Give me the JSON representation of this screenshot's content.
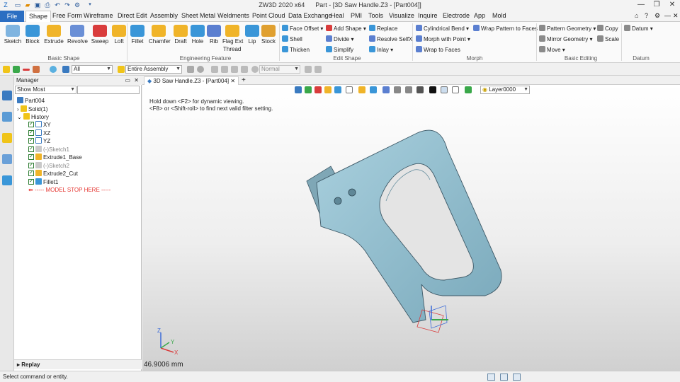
{
  "app": {
    "title": "ZW3D 2020 x64",
    "doc_title": "Part - [3D Saw Handle.Z3 - [Part004]]"
  },
  "window_controls": {
    "minimize": "—",
    "restore": "❐",
    "close": "✕"
  },
  "menu": {
    "file": "File",
    "tabs": [
      "Shape",
      "Free Form",
      "Wireframe",
      "Direct Edit",
      "Assembly",
      "Sheet Metal",
      "Weldments",
      "Point Cloud",
      "Data Exchange",
      "Heal",
      "PMI",
      "Tools",
      "Visualize",
      "Inquire",
      "Electrode",
      "App",
      "Mold"
    ]
  },
  "ribbon": {
    "basic_shape": {
      "label": "Basic Shape",
      "tools": [
        "Sketch",
        "Block",
        "Extrude",
        "Revolve",
        "Sweep",
        "Loft"
      ]
    },
    "engineering_feature": {
      "label": "Engineering Feature",
      "tools": [
        "Fillet",
        "Chamfer",
        "Draft",
        "Hole",
        "Rib",
        "Flag Ext",
        "Lip",
        "Stock"
      ],
      "extra": "Thread"
    },
    "edit_shape": {
      "label": "Edit Shape",
      "items": [
        "Face Offset",
        "Add Shape",
        "Replace",
        "Shell",
        "Divide",
        "Resolve SelfX",
        "Thicken",
        "Simplify",
        "Inlay"
      ]
    },
    "morph": {
      "label": "Morph",
      "items": [
        "Cylindrical Bend",
        "Wrap Pattern to Faces",
        "Morph with Point",
        "Wrap to Faces"
      ]
    },
    "basic_editing": {
      "label": "Basic Editing",
      "items": [
        "Pattern Geometry",
        "Copy",
        "Mirror Geometry",
        "Scale",
        "Move"
      ]
    },
    "datum": {
      "label": "Datum",
      "items": [
        "Datum"
      ]
    }
  },
  "toolbar2": {
    "filter_value": "All",
    "assembly_value": "Entire Assembly",
    "mode_value": "Normal"
  },
  "manager": {
    "title": "Manager",
    "filter": "Show Most",
    "root": "Part004",
    "solid": "Solid(1)",
    "history": "History",
    "items": [
      "XY",
      "XZ",
      "YZ",
      "(-)Sketch1",
      "Extrude1_Base",
      "(-)Sketch2",
      "Extrude2_Cut",
      "Fillet1"
    ],
    "stop": "----- MODEL STOP HERE -----",
    "replay": "Replay"
  },
  "viewport": {
    "tab": "3D Saw Handle.Z3 - [Part004]",
    "add_tab": "+",
    "layer": "Layer0000",
    "hint1": "Hold down <F2> for dynamic viewing.",
    "hint2": "<F8> or <Shift-roll> to find next valid filter setting.",
    "measurement": "46.9006 mm",
    "axes": {
      "x": "X",
      "y": "Y",
      "z": "Z"
    }
  },
  "status": {
    "text": "Select command or entity."
  },
  "colors": {
    "accent": "#2b6ec2",
    "model": "#8fb9c9",
    "stop": "#e53935"
  }
}
